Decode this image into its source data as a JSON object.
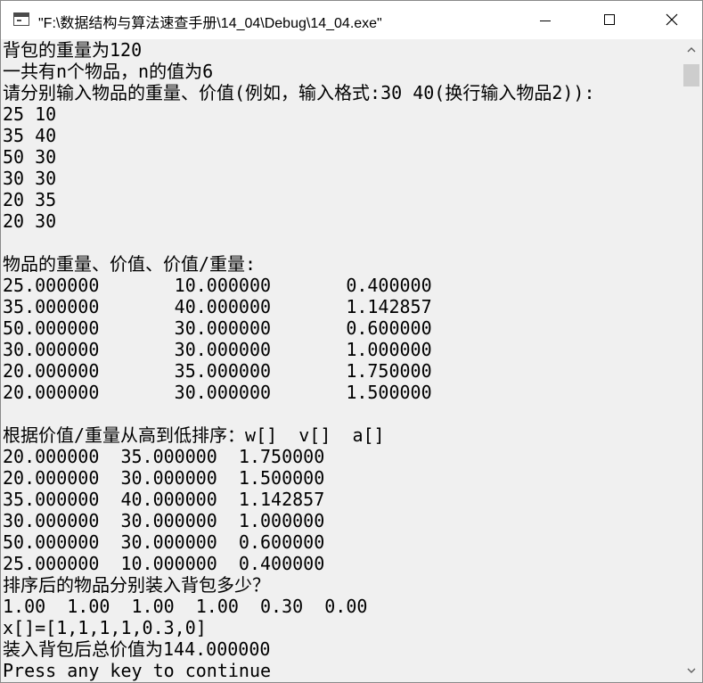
{
  "window": {
    "title": "\"F:\\数据结构与算法速查手册\\14_04\\Debug\\14_04.exe\""
  },
  "console": {
    "lines": [
      "背包的重量为120",
      "一共有n个物品，n的值为6",
      "请分别输入物品的重量、价值(例如，输入格式:30 40(换行输入物品2)):",
      "25 10",
      "35 40",
      "50 30",
      "30 30",
      "20 35",
      "20 30",
      "",
      "物品的重量、价值、价值/重量:",
      "25.000000       10.000000       0.400000",
      "35.000000       40.000000       1.142857",
      "50.000000       30.000000       0.600000",
      "30.000000       30.000000       1.000000",
      "20.000000       35.000000       1.750000",
      "20.000000       30.000000       1.500000",
      "",
      "根据价值/重量从高到低排序：w[]  v[]  a[]",
      "20.000000  35.000000  1.750000",
      "20.000000  30.000000  1.500000",
      "35.000000  40.000000  1.142857",
      "30.000000  30.000000  1.000000",
      "50.000000  30.000000  0.600000",
      "25.000000  10.000000  0.400000",
      "排序后的物品分别装入背包多少？",
      "1.00  1.00  1.00  1.00  0.30  0.00",
      "x[]=[1,1,1,1,0.3,0]",
      "装入背包后总价值为144.000000",
      "Press any key to continue"
    ]
  },
  "icons": {
    "app": "console-window-icon",
    "minimize": "minimize-icon",
    "maximize": "maximize-icon",
    "close": "close-icon",
    "scroll_up": "chevron-up-icon",
    "scroll_down": "chevron-down-icon"
  },
  "colors": {
    "titlebar": "#ffffff",
    "console_bg": "#f0f0f0",
    "console_text": "#000000",
    "scroll_thumb": "#cdcdcd"
  }
}
